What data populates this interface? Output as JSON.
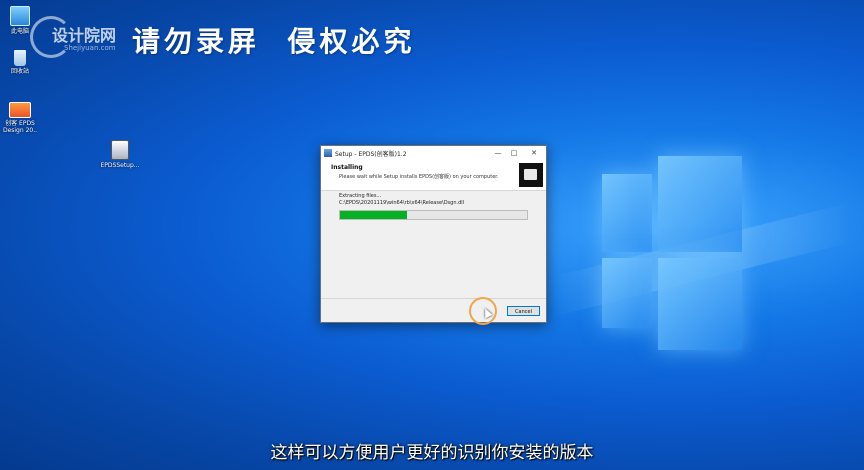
{
  "watermark": {
    "site_name": "设计院网",
    "site_url": "Shejiyuan.com",
    "warning": "请勿录屏  侵权必究"
  },
  "desktop_icons": [
    {
      "label": "此电脑",
      "icon": "computer-icon"
    },
    {
      "label": "回收站",
      "icon": "recycle-bin-icon"
    },
    {
      "label": "创客 EPDS Design 20..",
      "icon": "app-shortcut-icon"
    },
    {
      "label": "EPDSSetup...",
      "icon": "setup-exe-icon"
    }
  ],
  "dialog": {
    "title": "Setup - EPDS(创客版)1.2",
    "header_title": "Installing",
    "header_desc": "Please wait while Setup installs EPDS(创客版) on your computer.",
    "status_text": "Extracting files...",
    "current_file": "C:\\EPDS\\20201119\\win64\\rb\\x64\\Release\\Dsgn.dll",
    "progress": 0.36,
    "cancel_label": "Cancel",
    "min_label": "—",
    "max_label": "□",
    "close_label": "✕"
  },
  "subtitle": "这样可以方便用户更好的识别你安装的版本",
  "colors": {
    "progress_fill": "#06b025",
    "desktop_blue": "#0b5bd0"
  }
}
